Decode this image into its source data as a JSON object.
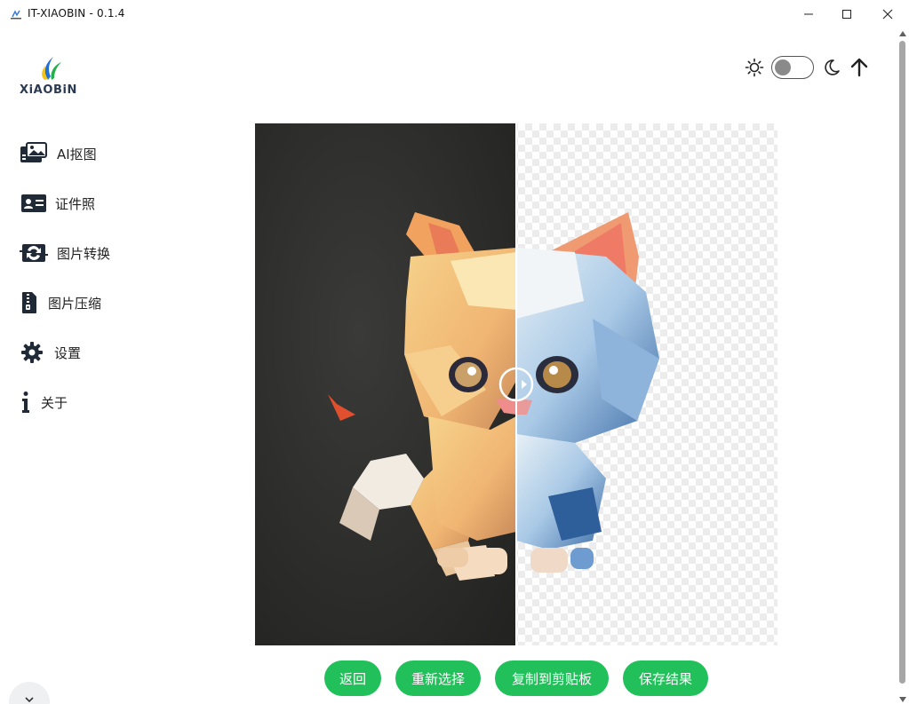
{
  "window": {
    "title": "IT-XIAOBIN - 0.1.4",
    "controls": [
      "minimize-icon",
      "maximize-icon",
      "close-icon"
    ]
  },
  "logo": {
    "text": "XiAOBiN"
  },
  "sidebar": {
    "items": [
      {
        "label": "AI抠图",
        "icon": "image-matting-icon"
      },
      {
        "label": "证件照",
        "icon": "id-card-icon"
      },
      {
        "label": "图片转换",
        "icon": "image-convert-icon"
      },
      {
        "label": "图片压缩",
        "icon": "zip-file-icon"
      },
      {
        "label": "设置",
        "icon": "gear-icon"
      },
      {
        "label": "关于",
        "icon": "info-icon"
      }
    ]
  },
  "theme": {
    "mode": "light",
    "icons": [
      "sun-icon",
      "moon-icon"
    ]
  },
  "compare": {
    "split_fraction": 0.5,
    "left": "original",
    "right": "background-removed"
  },
  "actions": {
    "back": "返回",
    "reselect": "重新选择",
    "copy": "复制到剪贴板",
    "save": "保存结果"
  },
  "colors": {
    "accent": "#22c05a",
    "dark_bg": "#2b2b2b"
  }
}
